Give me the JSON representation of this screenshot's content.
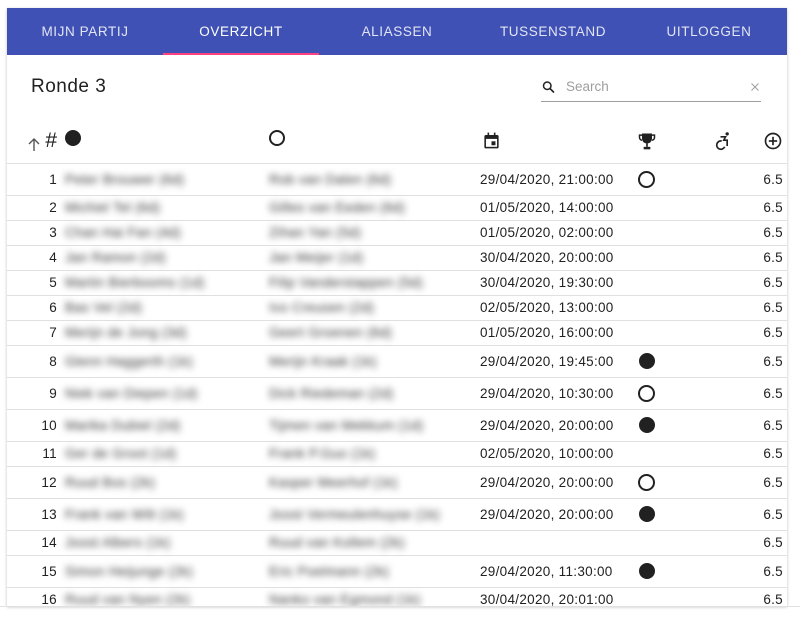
{
  "nav": {
    "tabs": [
      {
        "label": "MIJN PARTIJ",
        "active": false
      },
      {
        "label": "OVERZICHT",
        "active": true
      },
      {
        "label": "ALIASSEN",
        "active": false
      },
      {
        "label": "TUSSENSTAND",
        "active": false
      },
      {
        "label": "UITLOGGEN",
        "active": false
      }
    ]
  },
  "title": "Ronde 3",
  "search": {
    "placeholder": "Search",
    "value": ""
  },
  "table": {
    "header_hash": "#",
    "rows": [
      {
        "num": "1",
        "white": "Peter Brouwer (6d)",
        "black": "Rob van Dalen (6d)",
        "date": "29/04/2020, 21:00:00",
        "result": "open",
        "score": "6.5"
      },
      {
        "num": "2",
        "white": "Michiel Tel (6d)",
        "black": "Gilles van Eeden (6d)",
        "date": "01/05/2020, 14:00:00",
        "result": "",
        "score": "6.5"
      },
      {
        "num": "3",
        "white": "Chan Hai Fan (4d)",
        "black": "Zihan Yan (5d)",
        "date": "01/05/2020, 02:00:00",
        "result": "",
        "score": "6.5"
      },
      {
        "num": "4",
        "white": "Jan Ramon (2d)",
        "black": "Jan Meijer (1d)",
        "date": "30/04/2020, 20:00:00",
        "result": "",
        "score": "6.5"
      },
      {
        "num": "5",
        "white": "Martin Bierbooms (1d)",
        "black": "Filip Vanderstappen (5d)",
        "date": "30/04/2020, 19:30:00",
        "result": "",
        "score": "6.5"
      },
      {
        "num": "6",
        "white": "Bas Vel (2d)",
        "black": "Ivo Creusen (2d)",
        "date": "02/05/2020, 13:00:00",
        "result": "",
        "score": "6.5"
      },
      {
        "num": "7",
        "white": "Merijn de Jong (3d)",
        "black": "Geert Groenen (6d)",
        "date": "01/05/2020, 16:00:00",
        "result": "",
        "score": "6.5"
      },
      {
        "num": "8",
        "white": "Glenn Haggerth (1k)",
        "black": "Merijn Kraak (1k)",
        "date": "29/04/2020, 19:45:00",
        "result": "filled",
        "score": "6.5"
      },
      {
        "num": "9",
        "white": "Niek van Diepen (1d)",
        "black": "Dick Riedeman (2d)",
        "date": "29/04/2020, 10:30:00",
        "result": "open",
        "score": "6.5"
      },
      {
        "num": "10",
        "white": "Marika Dubiel (2d)",
        "black": "Tijmen van Mekkum (1d)",
        "date": "29/04/2020, 20:00:00",
        "result": "filled",
        "score": "6.5"
      },
      {
        "num": "11",
        "white": "Ger de Groot (1d)",
        "black": "Frank P.Guo (1k)",
        "date": "02/05/2020, 10:00:00",
        "result": "",
        "score": "6.5"
      },
      {
        "num": "12",
        "white": "Ruud Bos (2k)",
        "black": "Kasper Meerhof (1k)",
        "date": "29/04/2020, 20:00:00",
        "result": "open",
        "score": "6.5"
      },
      {
        "num": "13",
        "white": "Frank van Wilt (1k)",
        "black": "Joost Vermeulenhuyse (1k)",
        "date": "29/04/2020, 20:00:00",
        "result": "filled",
        "score": "6.5"
      },
      {
        "num": "14",
        "white": "Joost Albers (1k)",
        "black": "Ruud van Kollem (2k)",
        "date": "",
        "result": "",
        "score": "6.5"
      },
      {
        "num": "15",
        "white": "Simon Heijunge (2k)",
        "black": "Eric Poelmann (2k)",
        "date": "29/04/2020, 11:30:00",
        "result": "filled",
        "score": "6.5"
      },
      {
        "num": "16",
        "white": "Ruud van Nyen (2k)",
        "black": "Nanko van Egmond (1k)",
        "date": "30/04/2020, 20:01:00",
        "result": "",
        "score": "6.5"
      }
    ]
  },
  "colors": {
    "primary": "#3f51b5",
    "accent": "#ff4081"
  },
  "icons": {
    "sort": "arrow-up-icon",
    "white_player": "filled-circle-icon",
    "black_player": "open-circle-icon",
    "date": "calendar-icon",
    "result": "trophy-icon",
    "accessible": "accessible-forward-icon",
    "handicap": "add-circle-outline-icon",
    "search": "search-icon",
    "clear": "close-icon"
  }
}
